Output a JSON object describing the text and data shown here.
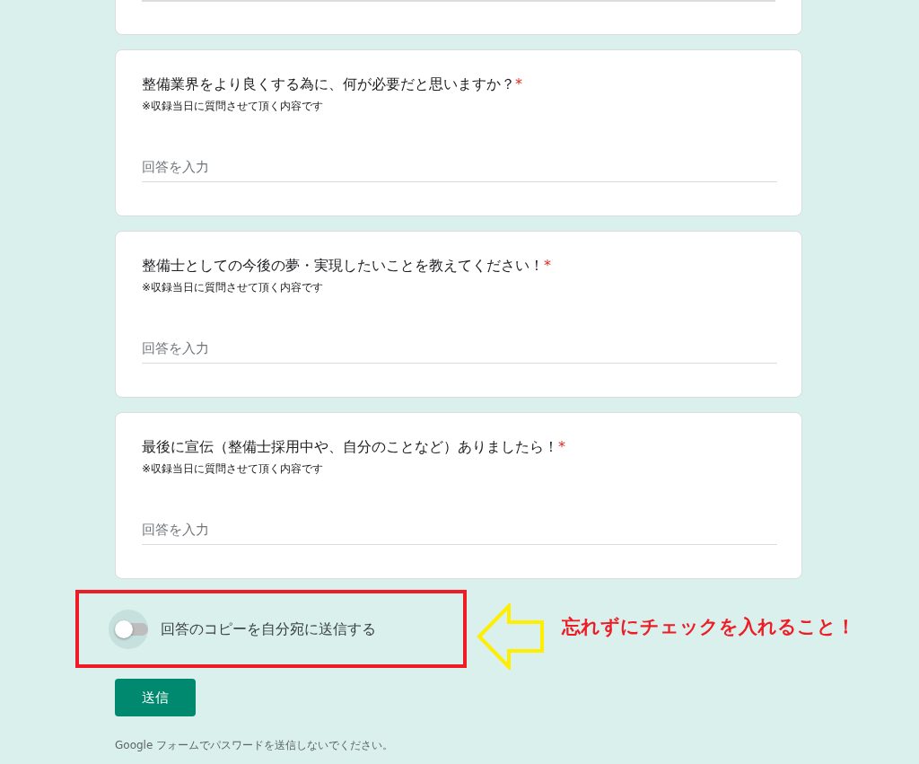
{
  "questions": [
    {
      "title": "整備業界をより良くする為に、何が必要だと思いますか？",
      "required": true,
      "description": "※収録当日に質問させて頂く内容です",
      "placeholder": "回答を入力"
    },
    {
      "title": "整備士としての今後の夢・実現したいことを教えてください！",
      "required": true,
      "description": "※収録当日に質問させて頂く内容です",
      "placeholder": "回答を入力"
    },
    {
      "title": "最後に宣伝（整備士採用中や、自分のことなど）ありましたら！",
      "required": true,
      "description": "※収録当日に質問させて頂く内容です",
      "placeholder": "回答を入力"
    }
  ],
  "required_mark": "*",
  "copy_toggle": {
    "label": "回答のコピーを自分宛に送信する",
    "checked": false
  },
  "submit_button": "送信",
  "footer_note": "Google フォームでパスワードを送信しないでください。",
  "annotation": {
    "text": "忘れずにチェックを入れること！"
  }
}
